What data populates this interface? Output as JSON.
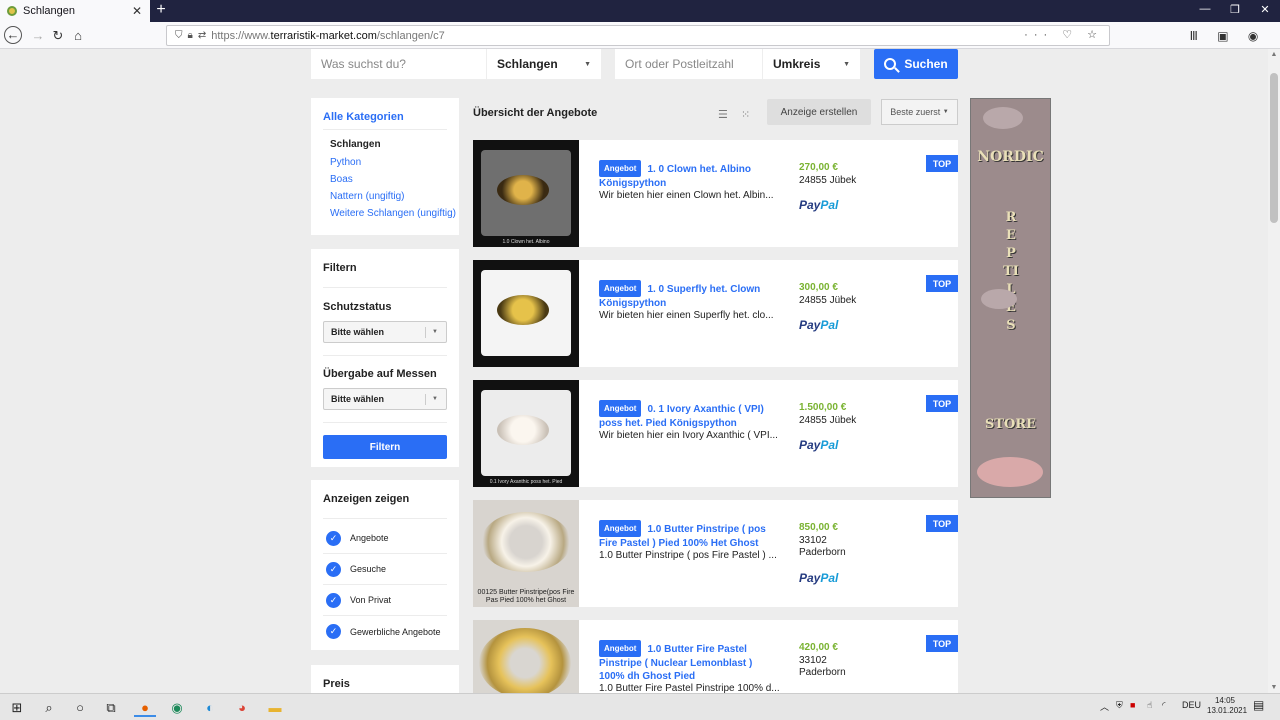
{
  "browser": {
    "tab_title": "Schlangen",
    "tab_close": "✕",
    "new_tab": "+",
    "url_prefix": "https://www.",
    "url_host": "terraristik-market.com",
    "url_path": "/schlangen/c7",
    "url_right_icons": "··· ♡ ☆",
    "toolbar_right": "Ⅲ ▣ ◉ ≡"
  },
  "search": {
    "query_placeholder": "Was suchst du?",
    "category_value": "Schlangen",
    "location_placeholder": "Ort oder Postleitzahl",
    "radius_value": "Umkreis",
    "submit_label": "Suchen"
  },
  "sidebar": {
    "categories_title": "Alle Kategorien",
    "current_category": "Schlangen",
    "subcategories": [
      "Python",
      "Boas",
      "Nattern (ungiftig)",
      "Weitere Schlangen (ungiftig)"
    ],
    "filter_title": "Filtern",
    "schutzstatus_label": "Schutzstatus",
    "schutzstatus_value": "Bitte wählen",
    "uebergabe_label": "Übergabe auf Messen",
    "uebergabe_value": "Bitte wählen",
    "filter_button": "Filtern",
    "anzeigen_title": "Anzeigen zeigen",
    "show_options": [
      "Angebote",
      "Gesuche",
      "Von Privat",
      "Gewerbliche Angebote"
    ],
    "price_title": "Preis"
  },
  "listings_header": {
    "title": "Übersicht der Angebote",
    "create_ad": "Anzeige erstellen",
    "sort_value": "Beste zuerst"
  },
  "listings": [
    {
      "badge": "Angebot",
      "title": "1. 0 Clown het. Albino Königspython",
      "desc": "Wir bieten hier einen Clown het. Albin...",
      "price": "270,00 €",
      "location": "24855 Jübek",
      "paypal": true,
      "top": "TOP",
      "thumb_caption": "1.0 Clown het. Albino"
    },
    {
      "badge": "Angebot",
      "title": "1. 0 Superfly het. Clown Königspython",
      "desc": "Wir bieten hier einen Superfly het. clo...",
      "price": "300,00 €",
      "location": "24855 Jübek",
      "paypal": true,
      "top": "TOP",
      "thumb_caption": ""
    },
    {
      "badge": "Angebot",
      "title": "0. 1 Ivory Axanthic ( VPI) poss het. Pied Königspython",
      "desc": "Wir bieten hier ein Ivory Axanthic ( VPI...",
      "price": "1.500,00 €",
      "location": "24855 Jübek",
      "paypal": true,
      "top": "TOP",
      "thumb_caption": "0.1 Ivory Axanthic poss het. Pied"
    },
    {
      "badge": "Angebot",
      "title": "1.0 Butter Pinstripe ( pos Fire Pastel ) Pied 100% Het Ghost",
      "desc": "1.0 Butter Pinstripe ( pos Fire Pastel ) ...",
      "price": "850,00 €",
      "location": "33102 Paderborn",
      "paypal": true,
      "top": "TOP",
      "thumb_caption": "00125 Butter Pinstripe(pos Fire Pas Pied 100% het Ghost"
    },
    {
      "badge": "Angebot",
      "title": "1.0 Butter Fire Pastel Pinstripe ( Nuclear Lemonblast ) 100% dh Ghost Pied",
      "desc": "1.0 Butter Fire Pastel Pinstripe 100% d...",
      "price": "420,00 €",
      "location": "33102 Paderborn",
      "paypal": false,
      "top": "TOP",
      "thumb_caption": ""
    }
  ],
  "paypal_label": [
    "Pay",
    "Pal"
  ],
  "ad": {
    "line1": "NORDIC",
    "line2": "REPTILES",
    "line3": "STORE"
  },
  "taskbar": {
    "lang": "DEU",
    "time": "14:05",
    "date": "13.01.2021"
  },
  "colors": {
    "accent": "#2a6ef5",
    "price": "#7ab332",
    "titlebar": "#202340"
  }
}
